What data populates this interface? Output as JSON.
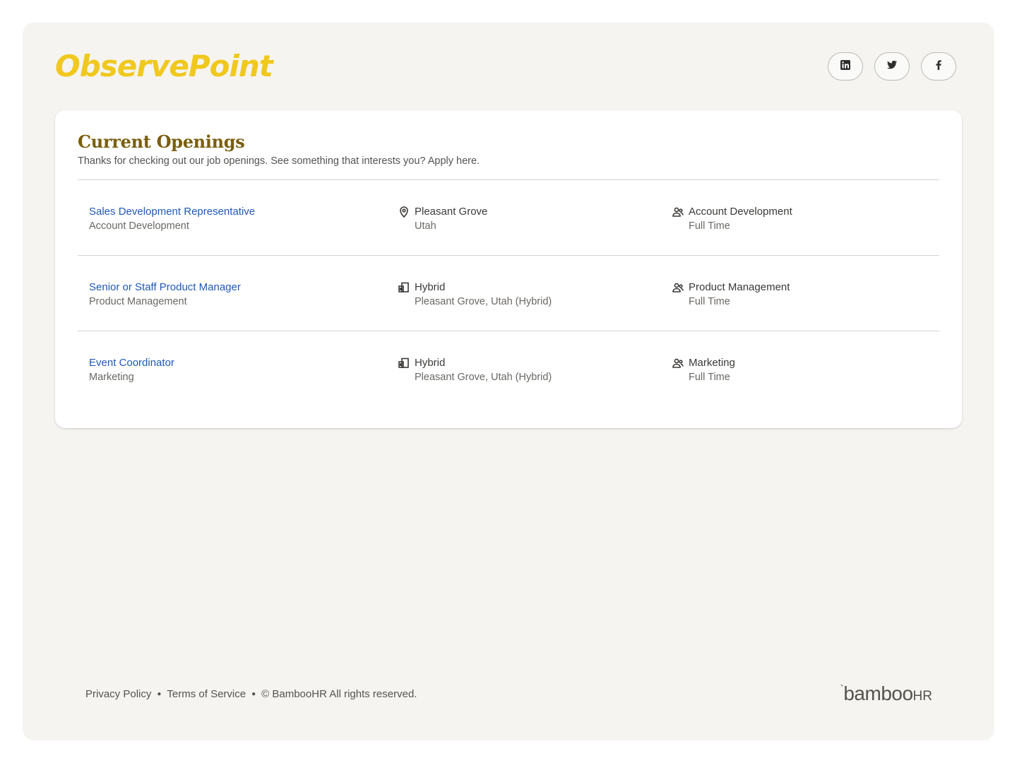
{
  "brand": {
    "logo_text": "ObservePoint",
    "logo_color": "#f0c81e"
  },
  "socials": [
    {
      "name": "linkedin",
      "icon": "linkedin-icon"
    },
    {
      "name": "twitter",
      "icon": "twitter-icon"
    },
    {
      "name": "facebook",
      "icon": "facebook-icon"
    }
  ],
  "openings": {
    "title": "Current Openings",
    "subtitle": "Thanks for checking out our job openings. See something that interests you? Apply here.",
    "jobs": [
      {
        "title": "Sales Development Representative",
        "department": "Account Development",
        "location_icon": "map-pin-icon",
        "location_title": "Pleasant Grove",
        "location_sub": "Utah",
        "team_title": "Account Development",
        "team_sub": "Full Time"
      },
      {
        "title": "Senior or Staff Product Manager",
        "department": "Product Management",
        "location_icon": "hybrid-building-icon",
        "location_title": "Hybrid",
        "location_sub": "Pleasant Grove, Utah (Hybrid)",
        "team_title": "Product Management",
        "team_sub": "Full Time"
      },
      {
        "title": "Event Coordinator",
        "department": "Marketing",
        "location_icon": "hybrid-building-icon",
        "location_title": "Hybrid",
        "location_sub": "Pleasant Grove, Utah (Hybrid)",
        "team_title": "Marketing",
        "team_sub": "Full Time"
      }
    ]
  },
  "footer": {
    "privacy": "Privacy Policy",
    "terms": "Terms of Service",
    "copyright": "© BambooHR All rights reserved.",
    "powered_by_main": "bamboo",
    "powered_by_suffix": "HR"
  },
  "colors": {
    "link": "#1f58b8",
    "heading": "#7a5e0c",
    "page_bg": "#f5f4f1"
  }
}
